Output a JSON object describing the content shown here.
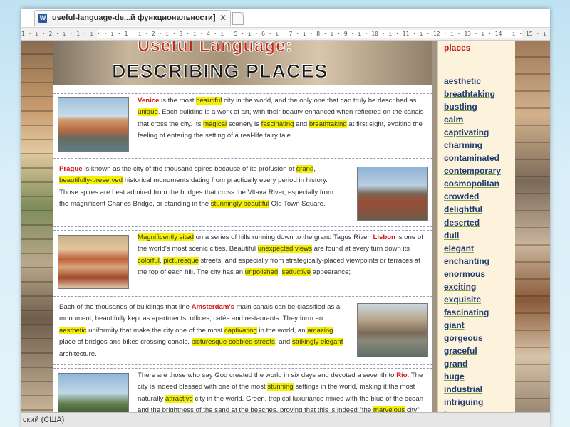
{
  "window": {
    "tab_title": "useful-language-de...й функциональности]",
    "tab_close": "✕",
    "ruler": "1 · ı · 2 · ı · 1 · ı ·   · ı · 1 · ı · 2 · ı · 3 · ı · 4 · ı · 5 · ı · 6 · ı · 7 · ı · 8 · ı · 9 · ı · 10 · ı · 11 · ı · 12 · ı · 13 · ı · 14 · ı · 15 · ı · 16 ·  ı · 17 · ı"
  },
  "header": {
    "line1": "Useful Language:",
    "line2": "DESCRIBING PLACES"
  },
  "blocks": [
    {
      "city": "Venice",
      "segments": [
        {
          "t": "Venice",
          "c": true
        },
        {
          "t": " is the most "
        },
        {
          "t": "beautiful",
          "h": true
        },
        {
          "t": " city in the world, and the only one that can truly be described as "
        },
        {
          "t": "unique",
          "h": true
        },
        {
          "t": ". Each building is a work of art, with their beauty enhanced when reflected on the canals that cross the city. Its "
        },
        {
          "t": "magical",
          "h": true
        },
        {
          "t": " scenery is "
        },
        {
          "t": "fascinating",
          "h": true
        },
        {
          "t": " and "
        },
        {
          "t": "breathtaking",
          "h": true
        },
        {
          "t": " at first sight, evoking the feeling of entering the setting of a real-life fairy tale."
        }
      ]
    },
    {
      "city": "Prague",
      "segments": [
        {
          "t": "Prague",
          "c": true
        },
        {
          "t": " is known as the city of the thousand spires because of its profusion of "
        },
        {
          "t": "grand",
          "h": true
        },
        {
          "t": ", "
        },
        {
          "t": "beautifully-preserved",
          "h": true
        },
        {
          "t": " historical monuments dating from practically every period in history. Those spires are best admired from the bridges that cross the Vltava River, especially from the magnificent Charles Bridge, or standing in the "
        },
        {
          "t": "stunningly beautiful",
          "h": true
        },
        {
          "t": " Old Town Square."
        }
      ]
    },
    {
      "city": "Lisbon",
      "segments": [
        {
          "t": "Magnificently sited",
          "h": true
        },
        {
          "t": " on a series of hills running down to the grand Tagus River, "
        },
        {
          "t": "Lisbon",
          "c": true
        },
        {
          "t": " is one of the world's most scenic cities. Beautiful "
        },
        {
          "t": "unexpected views",
          "h": true
        },
        {
          "t": " are found at every turn down its "
        },
        {
          "t": "colorful",
          "h": true
        },
        {
          "t": ", "
        },
        {
          "t": "picturesque",
          "h": true
        },
        {
          "t": " streets, and especially from strategically-placed viewpoints or terraces at the top of each hill. The city has an "
        },
        {
          "t": "unpolished",
          "h": true
        },
        {
          "t": ", "
        },
        {
          "t": "seductive",
          "h": true
        },
        {
          "t": " appearance;"
        }
      ]
    },
    {
      "city": "Amsterdam",
      "segments": [
        {
          "t": "Each of the thousands of buildings that line "
        },
        {
          "t": "Amsterdam's",
          "c": true
        },
        {
          "t": " main canals can be classified as a monument, beautifully kept as apartments, offices, cafés and restaurants. They form an "
        },
        {
          "t": "aesthetic",
          "h": true
        },
        {
          "t": " uniformity that make the city one of the most "
        },
        {
          "t": "captivating",
          "h": true
        },
        {
          "t": " in the world, an "
        },
        {
          "t": "amazing",
          "h": true
        },
        {
          "t": " place of bridges and bikes crossing canals, "
        },
        {
          "t": "picturesque cobbled streets",
          "h": true
        },
        {
          "t": ", and "
        },
        {
          "t": "strikingly elegant",
          "h": true
        },
        {
          "t": " architecture."
        }
      ]
    },
    {
      "city": "Rio",
      "segments": [
        {
          "t": "There are those who say God created the world in six days and devoted a seventh to "
        },
        {
          "t": "Rio",
          "c": true
        },
        {
          "t": ". The city is indeed blessed with one of the most "
        },
        {
          "t": "stunning",
          "h": true
        },
        {
          "t": " settings in the world, making it the most naturally "
        },
        {
          "t": "attractive",
          "h": true
        },
        {
          "t": " city in the world. Green, tropical luxuriance mixes with the blue of the ocean and the brightness of the sand at the beaches, proving that this is indeed \"the "
        },
        {
          "t": "marvelous",
          "h": true
        },
        {
          "t": " city\" as locals call"
        }
      ]
    }
  ],
  "wordlist": {
    "title": "places",
    "words": [
      "aesthetic",
      "breathtaking",
      "bustling",
      "calm",
      "captivating",
      "charming",
      "contaminated",
      "contemporary",
      "cosmopolitan",
      "crowded",
      "delightful",
      "deserted",
      "dull",
      "elegant",
      "enchanting",
      "enormous",
      "exciting",
      "exquisite",
      "fascinating",
      "giant",
      "gorgeous",
      "graceful",
      "grand",
      "huge",
      "industrial",
      "intriguing",
      "large"
    ]
  },
  "statusbar": {
    "language": "ский (США)"
  },
  "colors": {
    "city_name": "#d0161a",
    "highlight": "#f4f000",
    "word_link": "#1f3a6e",
    "panel_bg": "#fdf3dc"
  }
}
